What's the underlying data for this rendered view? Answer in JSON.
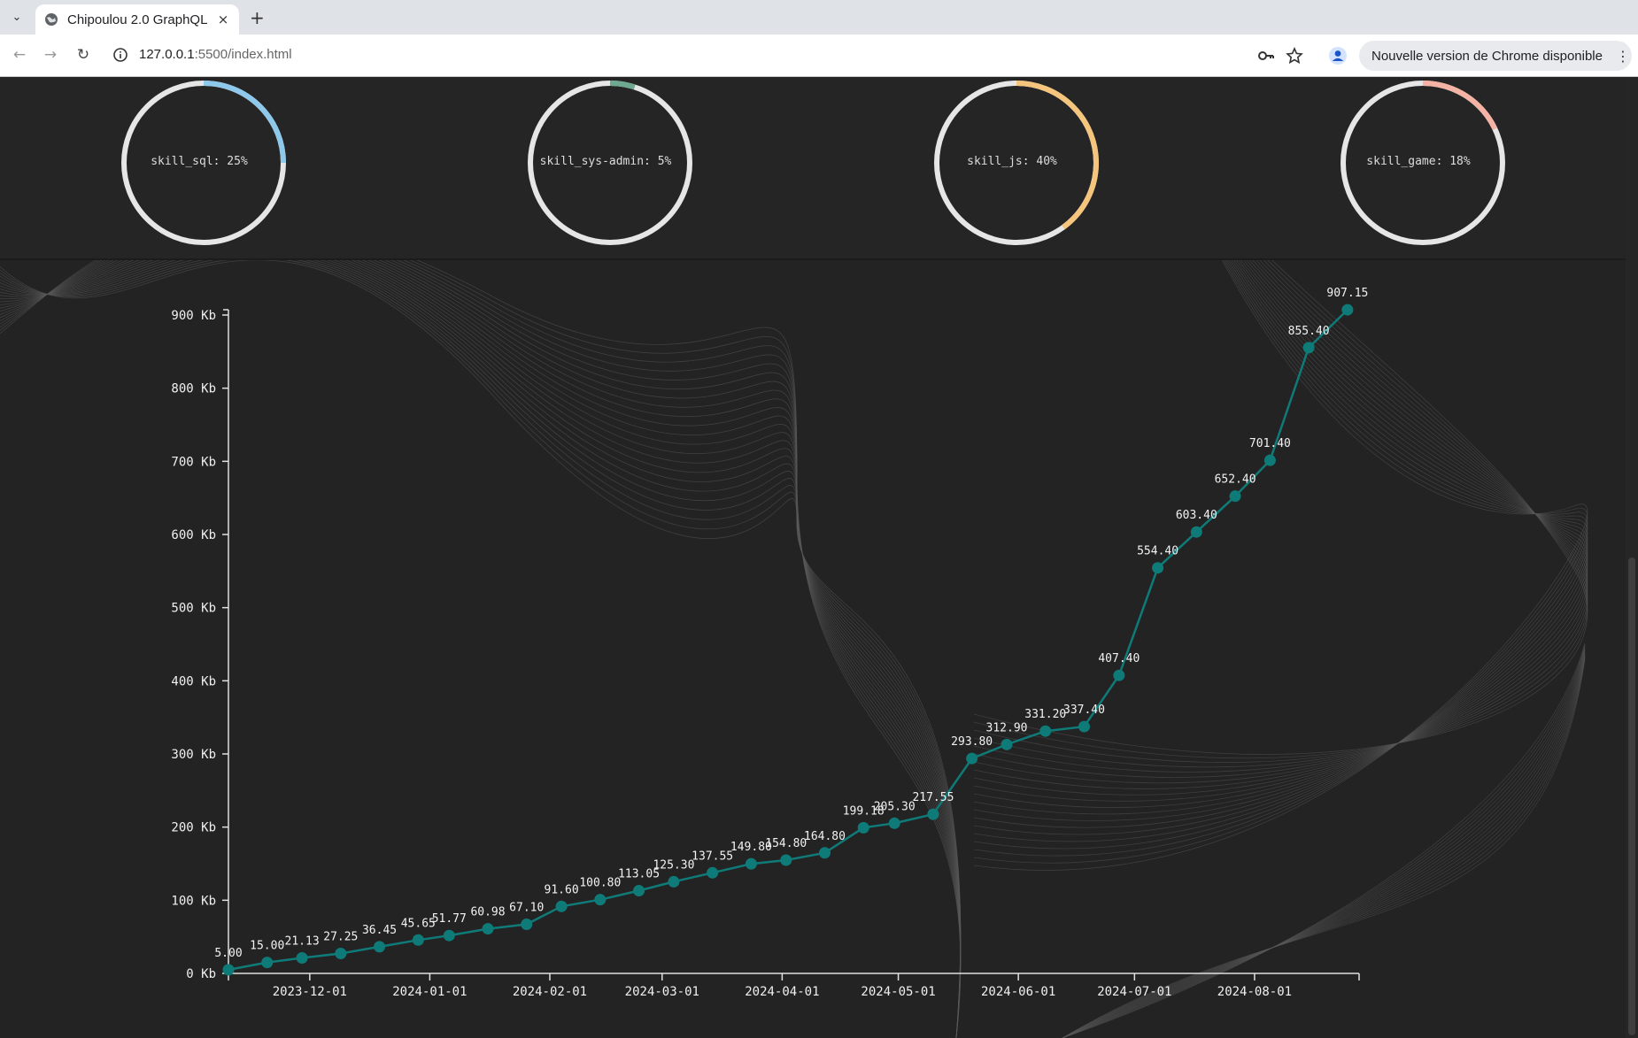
{
  "browser": {
    "tab_title": "Chipoulou 2.0 GraphQL",
    "tab_close": "×",
    "new_tab": "+",
    "url_host": "127.0.0.1",
    "url_rest": ":5500/index.html",
    "update_text": "Nouvelle version de Chrome disponible",
    "update_menu": "⋮"
  },
  "skills": [
    {
      "label": "skill_sql: 25%",
      "percent": 25,
      "color": "#8ec8ea"
    },
    {
      "label": "skill_sys-admin: 5%",
      "percent": 5,
      "color": "#6fa890"
    },
    {
      "label": "skill_js: 40%",
      "percent": 40,
      "color": "#f5c57d"
    },
    {
      "label": "skill_game: 18%",
      "percent": 18,
      "color": "#f4b3a4"
    }
  ],
  "chart_data": {
    "type": "line",
    "title": "",
    "xlabel": "",
    "ylabel": "",
    "y_unit": "Kb",
    "ylim": [
      0,
      900
    ],
    "y_ticks": [
      0,
      100,
      200,
      300,
      400,
      500,
      600,
      700,
      800,
      900
    ],
    "y_tick_labels": [
      "0 Kb",
      "100 Kb",
      "200 Kb",
      "300 Kb",
      "400 Kb",
      "500 Kb",
      "600 Kb",
      "700 Kb",
      "800 Kb",
      "900 Kb"
    ],
    "x_type": "date",
    "x_range": [
      "2023-11-10",
      "2024-08-28"
    ],
    "x_tick_labels": [
      "2023-12-01",
      "2024-01-01",
      "2024-02-01",
      "2024-03-01",
      "2024-04-01",
      "2024-05-01",
      "2024-06-01",
      "2024-07-01",
      "2024-08-01"
    ],
    "line_color": "#0f7b79",
    "grid": false,
    "points": [
      {
        "x": "2023-11-10",
        "y": 5.0,
        "label": "5.00"
      },
      {
        "x": "2023-11-20",
        "y": 15.0,
        "label": "15.00"
      },
      {
        "x": "2023-11-29",
        "y": 21.13,
        "label": "21.13"
      },
      {
        "x": "2023-12-09",
        "y": 27.25,
        "label": "27.25"
      },
      {
        "x": "2023-12-19",
        "y": 36.45,
        "label": "36.45"
      },
      {
        "x": "2023-12-29",
        "y": 45.65,
        "label": "45.65"
      },
      {
        "x": "2024-01-06",
        "y": 51.77,
        "label": "51.77"
      },
      {
        "x": "2024-01-16",
        "y": 60.98,
        "label": "60.98"
      },
      {
        "x": "2024-01-26",
        "y": 67.1,
        "label": "67.10"
      },
      {
        "x": "2024-02-04",
        "y": 91.6,
        "label": "91.60"
      },
      {
        "x": "2024-02-14",
        "y": 100.8,
        "label": "100.80"
      },
      {
        "x": "2024-02-24",
        "y": 113.05,
        "label": "113.05"
      },
      {
        "x": "2024-03-04",
        "y": 125.3,
        "label": "125.30"
      },
      {
        "x": "2024-03-14",
        "y": 137.55,
        "label": "137.55"
      },
      {
        "x": "2024-03-24",
        "y": 149.8,
        "label": "149.80"
      },
      {
        "x": "2024-04-02",
        "y": 154.8,
        "label": "154.80"
      },
      {
        "x": "2024-04-12",
        "y": 164.8,
        "label": "164.80"
      },
      {
        "x": "2024-04-22",
        "y": 199.18,
        "label": "199.18"
      },
      {
        "x": "2024-04-30",
        "y": 205.3,
        "label": "205.30"
      },
      {
        "x": "2024-05-10",
        "y": 217.55,
        "label": "217.55"
      },
      {
        "x": "2024-05-20",
        "y": 293.8,
        "label": "293.80"
      },
      {
        "x": "2024-05-29",
        "y": 312.9,
        "label": "312.90"
      },
      {
        "x": "2024-06-08",
        "y": 331.2,
        "label": "331.20"
      },
      {
        "x": "2024-06-18",
        "y": 337.4,
        "label": "337.40"
      },
      {
        "x": "2024-06-27",
        "y": 407.4,
        "label": "407.40"
      },
      {
        "x": "2024-07-07",
        "y": 554.4,
        "label": "554.40"
      },
      {
        "x": "2024-07-17",
        "y": 603.4,
        "label": "603.40"
      },
      {
        "x": "2024-07-27",
        "y": 652.4,
        "label": "652.40"
      },
      {
        "x": "2024-08-05",
        "y": 701.4,
        "label": "701.40"
      },
      {
        "x": "2024-08-15",
        "y": 855.4,
        "label": "855.40"
      },
      {
        "x": "2024-08-25",
        "y": 907.15,
        "label": "907.15"
      }
    ]
  }
}
